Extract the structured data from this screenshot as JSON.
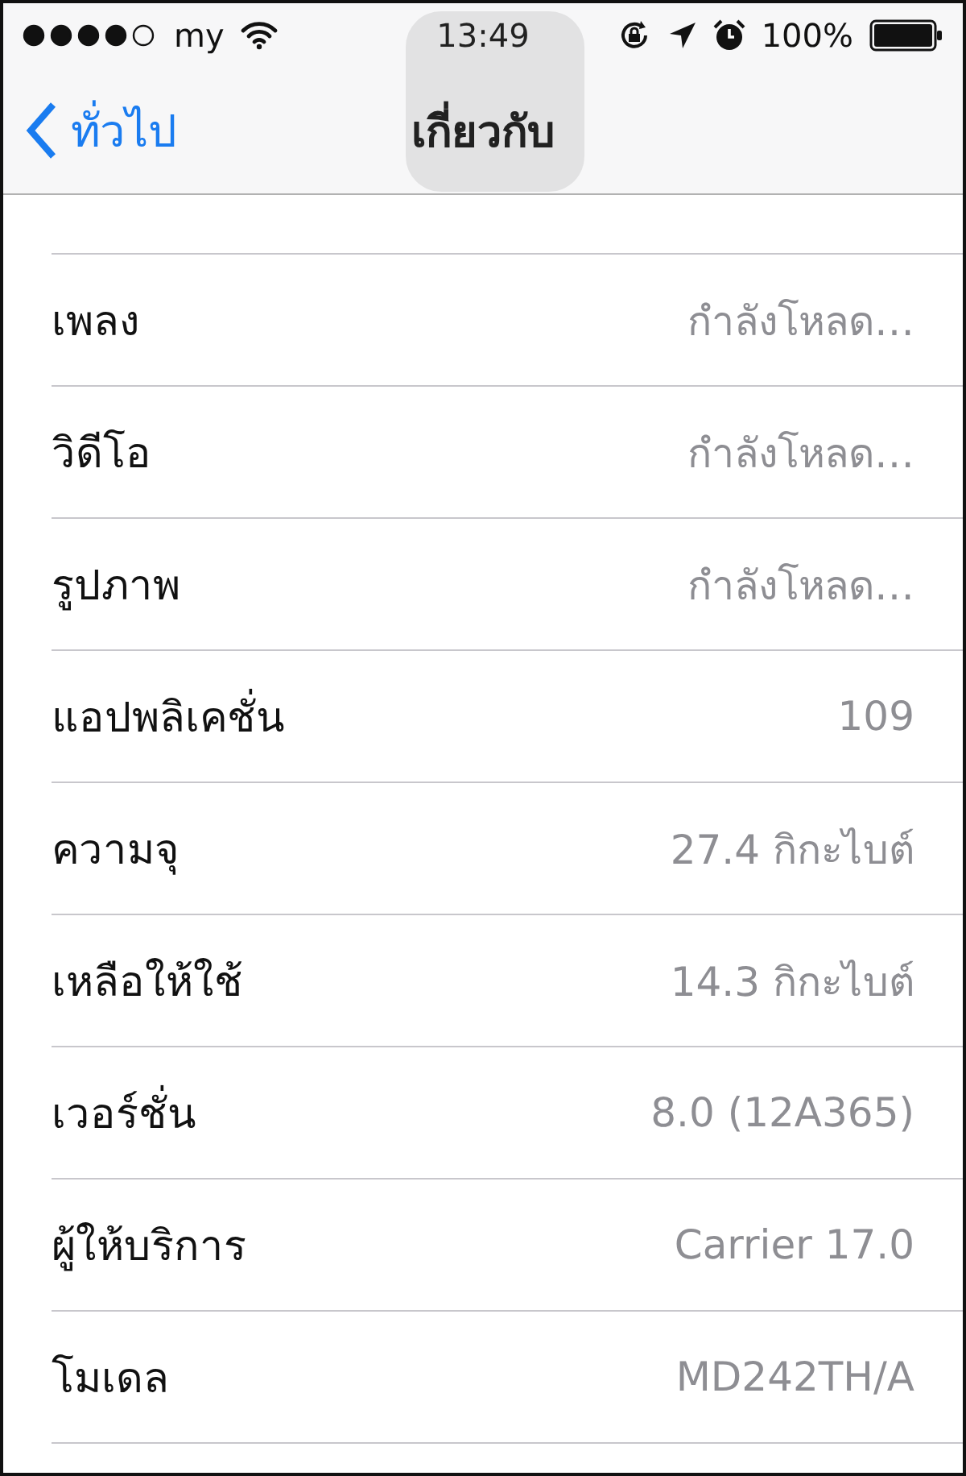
{
  "status_bar": {
    "carrier": "my",
    "time": "13:49",
    "battery": "100%"
  },
  "nav_bar": {
    "back": "ทั่วไป",
    "title": "เกี่ยวกับ"
  },
  "rows": [
    {
      "label": "เพลง",
      "value": "กำลังโหลด…"
    },
    {
      "label": "วิดีโอ",
      "value": "กำลังโหลด…"
    },
    {
      "label": "รูปภาพ",
      "value": "กำลังโหลด…"
    },
    {
      "label": "แอปพลิเคชั่น",
      "value": "109"
    },
    {
      "label": "ความจุ",
      "value": "27.4 กิกะไบต์"
    },
    {
      "label": "เหลือให้ใช้",
      "value": "14.3 กิกะไบต์"
    },
    {
      "label": "เวอร์ชั่น",
      "value": "8.0 (12A365)"
    },
    {
      "label": "ผู้ให้บริการ",
      "value": "Carrier 17.0"
    },
    {
      "label": "โมเดล",
      "value": "MD242TH/A"
    }
  ]
}
